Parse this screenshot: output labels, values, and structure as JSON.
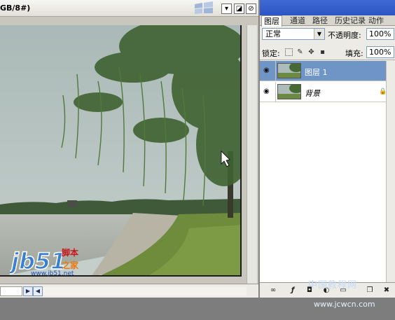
{
  "document": {
    "title": "GB/8#)",
    "buttons": {
      "minimize": "▾",
      "maximize": "◪",
      "close": "⊘"
    }
  },
  "watermark": {
    "logo": "jb51",
    "cn_top": "脚本",
    "cn_bottom": "之家",
    "url": "www.jb51.net"
  },
  "panel": {
    "tabs": [
      {
        "label": "图层",
        "active": true
      },
      {
        "label": "通道",
        "active": false
      },
      {
        "label": "路径",
        "active": false
      },
      {
        "label": "历史记录",
        "active": false
      },
      {
        "label": "动作",
        "active": false
      }
    ],
    "blend_mode": "正常",
    "opacity_label": "不透明度:",
    "opacity_value": "100%",
    "lock_label": "锁定:",
    "fill_label": "填充:",
    "fill_value": "100%",
    "layers": [
      {
        "name": "图层 1",
        "selected": true,
        "locked": false
      },
      {
        "name": "背景",
        "selected": false,
        "locked": true
      }
    ]
  },
  "site_watermark": {
    "top": "中国教程网",
    "bottom": "www.jcwcn.com"
  },
  "icons": {
    "eye": "eye-icon",
    "lock": "lock-icon",
    "link": "link-layers-icon",
    "fx": "fx-icon",
    "mask": "add-mask-icon",
    "adjust": "adjustment-layer-icon",
    "folder": "new-group-icon",
    "new": "new-layer-icon",
    "trash": "trash-icon"
  },
  "colors": {
    "selection": "#6f95c6",
    "panel_header": "#2a55c2"
  }
}
